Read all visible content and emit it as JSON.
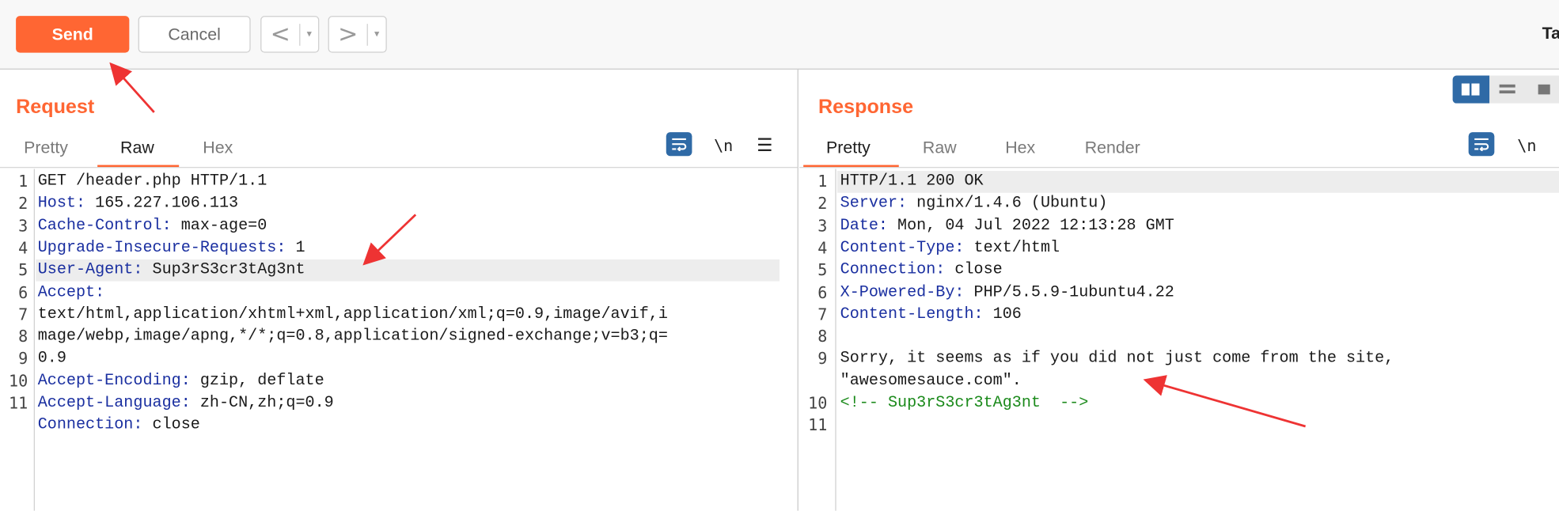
{
  "toolbar": {
    "send_label": "Send",
    "cancel_label": "Cancel",
    "back_arrow": "<",
    "forward_arrow": ">",
    "dropdown_caret": "▾",
    "right_text": "Ta"
  },
  "request": {
    "title": "Request",
    "tabs": [
      "Pretty",
      "Raw",
      "Hex"
    ],
    "active_tab": "Raw",
    "newline_toggle": "\\n",
    "menu_glyph": "☰",
    "line_numbers": [
      "1",
      "2",
      "3",
      "4",
      "5",
      "6",
      "7",
      "8",
      "9",
      "10",
      "11"
    ],
    "lines": [
      {
        "value": "GET /header.php HTTP/1.1"
      },
      {
        "key": "Host",
        "value": " 165.227.106.113"
      },
      {
        "key": "Cache-Control",
        "value": " max-age=0"
      },
      {
        "key": "Upgrade-Insecure-Requests",
        "value": " 1"
      },
      {
        "key": "User-Agent",
        "value": " Sup3rS3cr3tAg3nt"
      },
      {
        "key": "Accept",
        "value": ""
      },
      {
        "value": "text/html,application/xhtml+xml,application/xml;q=0.9,image/avif,i"
      },
      {
        "value": "mage/webp,image/apng,*/*;q=0.8,application/signed-exchange;v=b3;q="
      },
      {
        "value": "0.9"
      },
      {
        "key": "Accept-Encoding",
        "value": " gzip, deflate"
      },
      {
        "key": "Accept-Language",
        "value": " zh-CN,zh;q=0.9"
      },
      {
        "key": "Connection",
        "value": " close"
      }
    ]
  },
  "response": {
    "title": "Response",
    "tabs": [
      "Pretty",
      "Raw",
      "Hex",
      "Render"
    ],
    "active_tab": "Pretty",
    "newline_toggle": "\\n",
    "line_numbers": [
      "1",
      "2",
      "3",
      "4",
      "5",
      "6",
      "7",
      "8",
      "9",
      "",
      "10",
      "11"
    ],
    "lines": [
      {
        "value": "HTTP/1.1 200 OK"
      },
      {
        "key": "Server",
        "value": " nginx/1.4.6 (Ubuntu)"
      },
      {
        "key": "Date",
        "value": " Mon, 04 Jul 2022 12:13:28 GMT"
      },
      {
        "key": "Content-Type",
        "value": " text/html"
      },
      {
        "key": "Connection",
        "value": " close"
      },
      {
        "key": "X-Powered-By",
        "value": " PHP/5.5.9-1ubuntu4.22"
      },
      {
        "key": "Content-Length",
        "value": " 106"
      },
      {
        "value": ""
      },
      {
        "value": "Sorry, it seems as if you did not just come from the site,"
      },
      {
        "value": "\"awesomesauce.com\"."
      },
      {
        "comment": "<!-- Sup3rS3cr3tAg3nt  -->"
      },
      {
        "value": ""
      }
    ]
  },
  "colors": {
    "accent": "#ff6633",
    "header_key": "#1a2fa0",
    "comment": "#1b8a1b",
    "control_blue": "#2f6aa6",
    "annotation_arrow": "#ee3333"
  },
  "icons": {
    "word_wrap": "wrap-lines-icon",
    "layout_side_by_side": "split-columns-icon",
    "layout_stacked": "split-rows-icon"
  }
}
